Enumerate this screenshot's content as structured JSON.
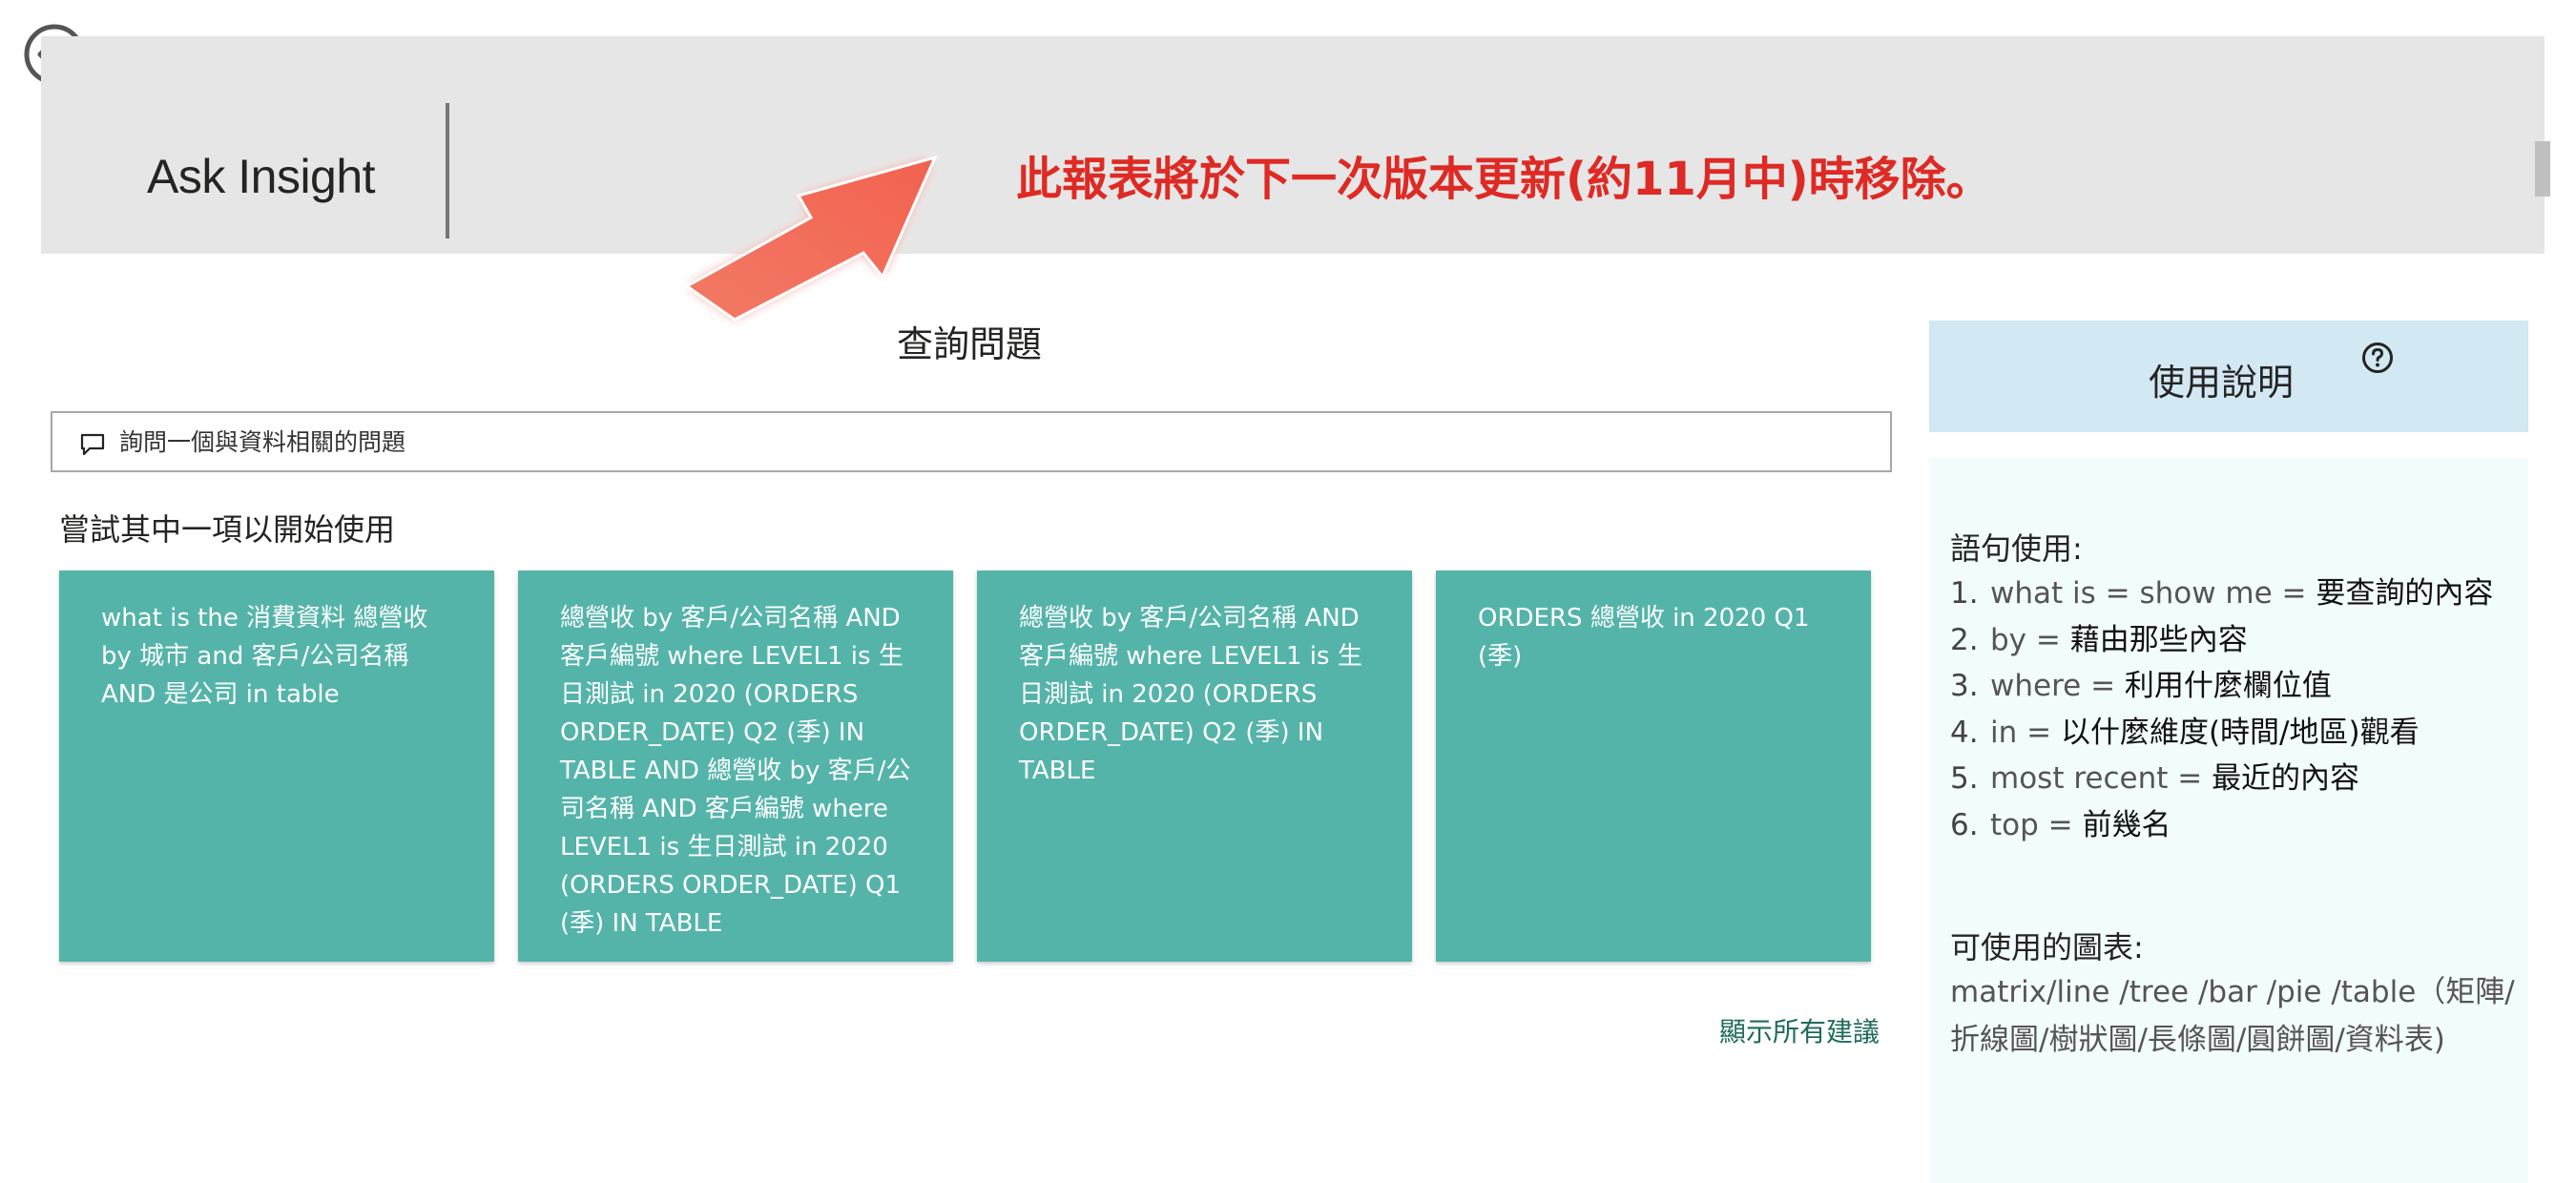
{
  "header": {
    "title": "Ask Insight",
    "notice": "此報表將於下一次版本更新(約11月中)時移除。"
  },
  "colors": {
    "header_bg": "#e6e6e6",
    "notice_red": "#de2a24",
    "card_teal": "#55b4aa",
    "help_header_bg": "#d2e8f3",
    "help_panel_bg": "#f3fcfd",
    "link_green": "#1f6b5a"
  },
  "icons": {
    "back": "circle-arrow-left-icon",
    "search": "speech-bubble-icon",
    "help": "question-circle-icon",
    "annotation": "red-arrow-annotation"
  },
  "main": {
    "section_title": "查詢問題",
    "search_placeholder": "詢問一個與資料相關的問題",
    "try_label": "嘗試其中一項以開始使用",
    "suggestions": [
      "what is the 消費資料 總營收 by 城市 and 客戶/公司名稱 AND 是公司 in table",
      "總營收 by 客戶/公司名稱 AND 客戶編號 where LEVEL1 is 生日測試 in 2020 (ORDERS ORDER_DATE) Q2 (季) IN TABLE AND 總營收 by 客戶/公司名稱 AND 客戶編號 where LEVEL1 is 生日測試 in 2020 (ORDERS ORDER_DATE) Q1 (季) IN TABLE",
      "總營收 by 客戶/公司名稱 AND 客戶編號 where LEVEL1 is 生日測試 in 2020 (ORDERS ORDER_DATE) Q2 (季) IN TABLE",
      "ORDERS 總營收 in 2020 Q1 (季)"
    ],
    "show_all": "顯示所有建議"
  },
  "help": {
    "title": "使用說明",
    "syntax_heading": "語句使用:",
    "syntax_items": [
      {
        "num": "1.",
        "keyword": "what is = show me = ",
        "desc": "要查詢的內容"
      },
      {
        "num": "2.",
        "keyword": "by = ",
        "desc": "藉由那些內容"
      },
      {
        "num": "3.",
        "keyword": "where = ",
        "desc": "利用什麼欄位值"
      },
      {
        "num": "4.",
        "keyword": "in = ",
        "desc": "以什麼維度(時間/地區)觀看"
      },
      {
        "num": "5.",
        "keyword": "most recent = ",
        "desc": "最近的內容"
      },
      {
        "num": "6.",
        "keyword": "top = ",
        "desc": "前幾名"
      }
    ],
    "charts_heading": "可使用的圖表:",
    "charts_text": "matrix/line /tree /bar /pie /table（矩陣/折線圖/樹狀圖/長條圖/圓餅圖/資料表)"
  }
}
